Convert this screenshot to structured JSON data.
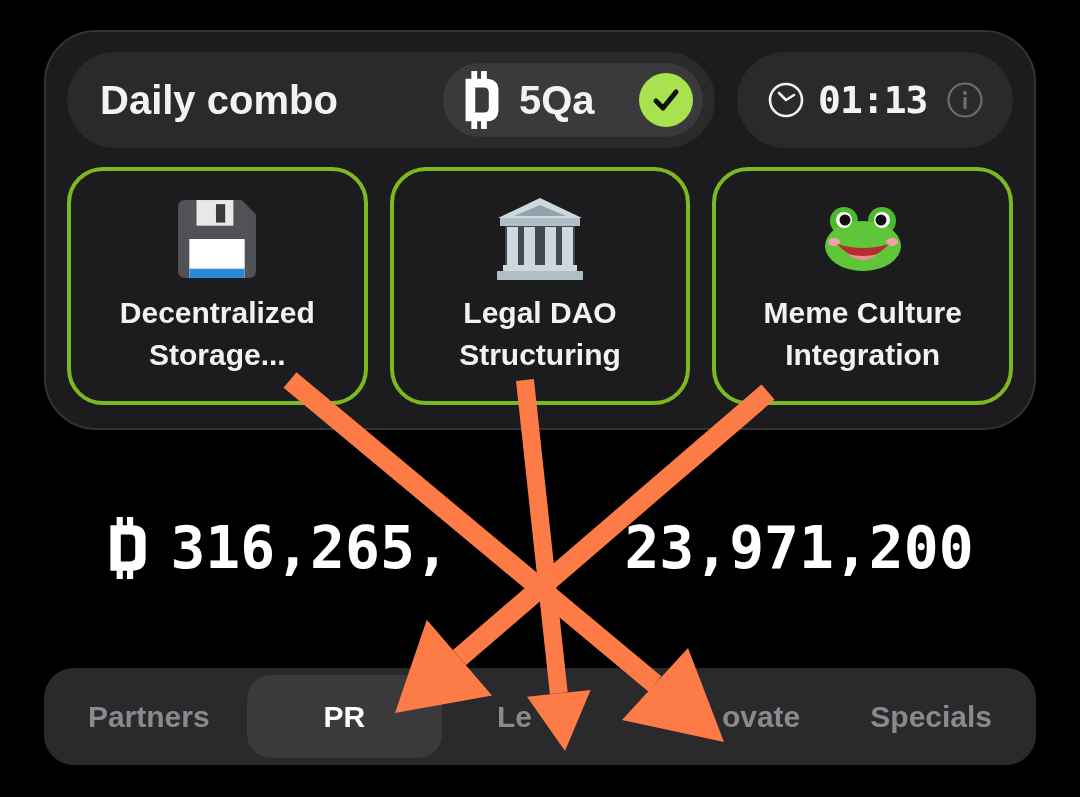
{
  "combo": {
    "title": "Daily combo",
    "reward": {
      "amount": "5Qa",
      "claimed": true
    },
    "timer": {
      "time": "01:13"
    }
  },
  "combo_cards": [
    {
      "kind": "floppy-disk",
      "label": "Decentralized Storage...",
      "found": true
    },
    {
      "kind": "classical-building",
      "label": "Legal DAO Structuring",
      "found": true
    },
    {
      "kind": "frog",
      "label": "Meme Culture Integration",
      "found": true
    }
  ],
  "balance": {
    "amount_parts": [
      "316,265,",
      "23,971,200"
    ]
  },
  "tabs": [
    {
      "label": "Partners",
      "selected": false,
      "covered_start": false,
      "covered_end": false
    },
    {
      "label": "PR",
      "selected": true,
      "covered_start": false,
      "covered_end": false
    },
    {
      "label": "Le",
      "selected": false,
      "covered_start": false,
      "covered_end": true
    },
    {
      "label": "ovate",
      "selected": false,
      "covered_start": true,
      "covered_end": false
    },
    {
      "label": "Specials",
      "selected": false,
      "covered_start": false,
      "covered_end": false
    }
  ]
}
